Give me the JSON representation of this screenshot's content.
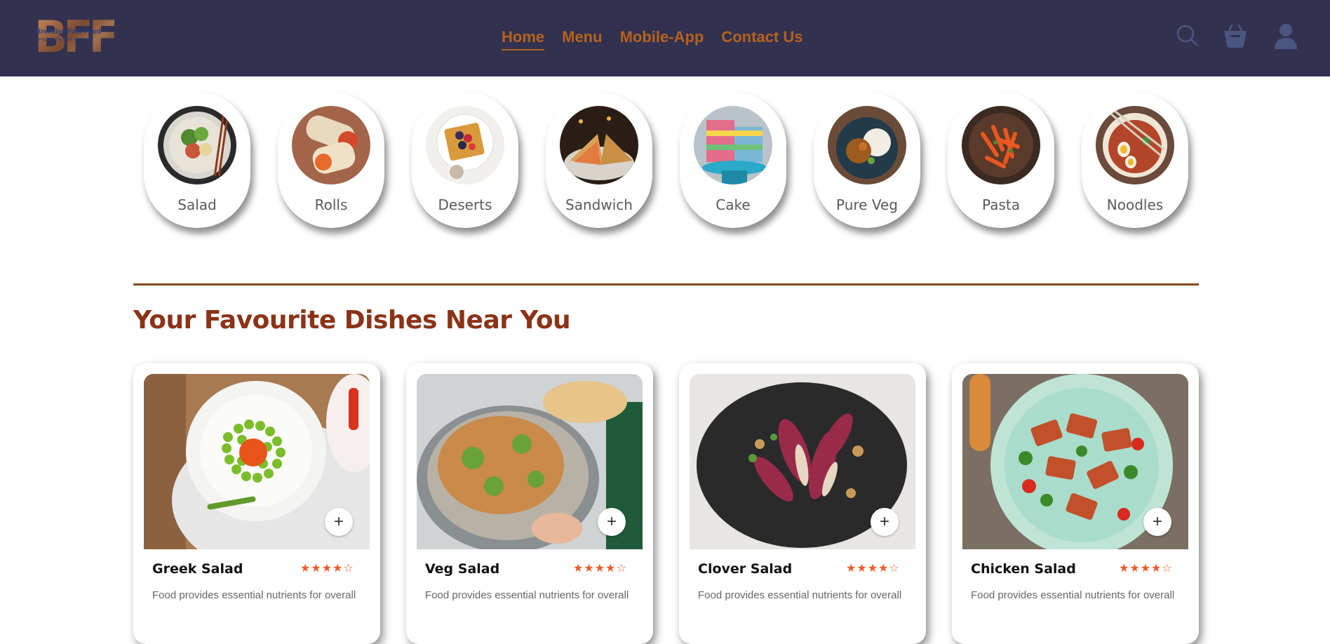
{
  "header": {
    "logo_letters": "BFF",
    "logo_text": "Breedlys Fast Food",
    "logo_sub": "Tasty, healthy, fresh delivered",
    "nav": [
      {
        "label": "Home",
        "active": true
      },
      {
        "label": "Menu",
        "active": false
      },
      {
        "label": "Mobile-App",
        "active": false
      },
      {
        "label": "Contact Us",
        "active": false
      }
    ],
    "icons": [
      "search-icon",
      "basket-icon",
      "user-icon"
    ]
  },
  "categories": [
    {
      "label": "Salad"
    },
    {
      "label": "Rolls"
    },
    {
      "label": "Deserts"
    },
    {
      "label": "Sandwich"
    },
    {
      "label": "Cake"
    },
    {
      "label": "Pure Veg"
    },
    {
      "label": "Pasta"
    },
    {
      "label": "Noodles"
    }
  ],
  "section": {
    "title": "Your Favourite Dishes Near You"
  },
  "dishes": [
    {
      "name": "Greek Salad",
      "rating": 4,
      "desc": "Food provides essential nutrients for overall"
    },
    {
      "name": "Veg Salad",
      "rating": 4,
      "desc": "Food provides essential nutrients for overall"
    },
    {
      "name": "Clover Salad",
      "rating": 4,
      "desc": "Food provides essential nutrients for overall"
    },
    {
      "name": "Chicken Salad",
      "rating": 4,
      "desc": "Food provides essential nutrients for overall"
    }
  ],
  "add_label": "+",
  "stars_text": "★★★★☆",
  "colors": {
    "header_bg": "#323150",
    "nav_text": "#b5621d",
    "title": "#8b3318",
    "star": "#f05a28"
  }
}
